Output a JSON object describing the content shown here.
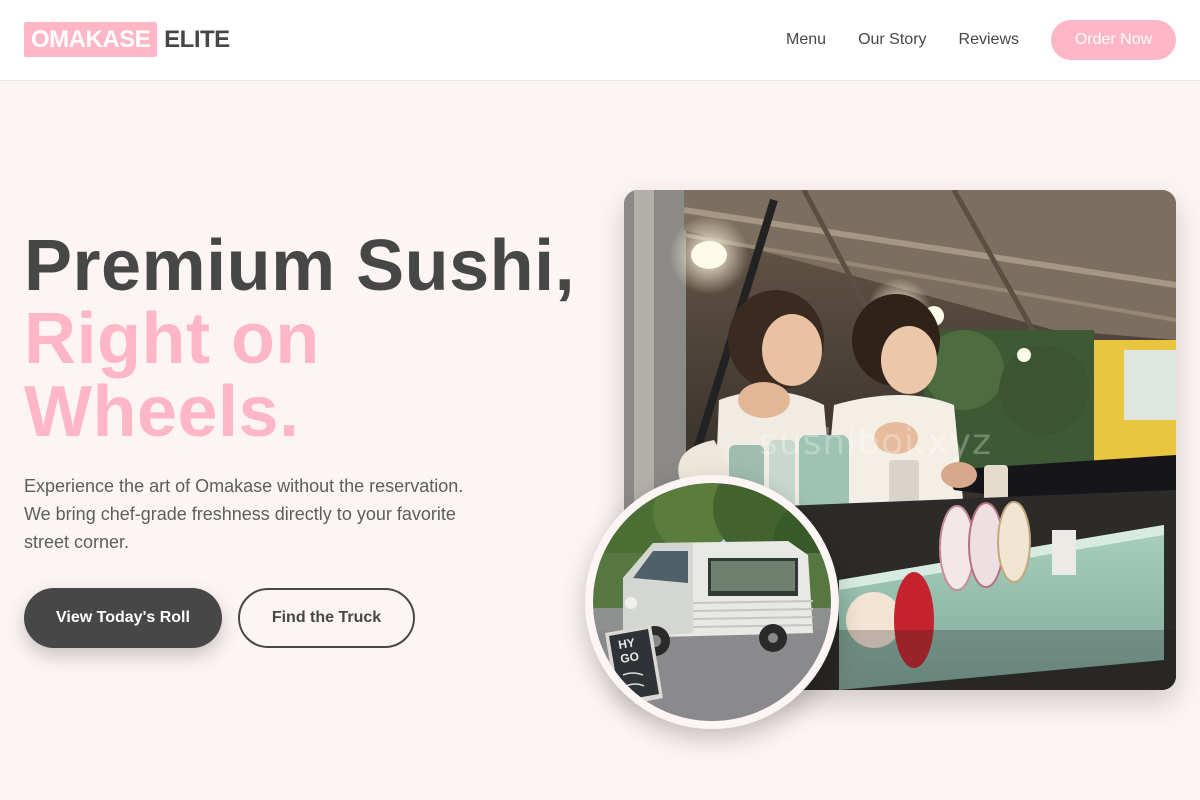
{
  "header": {
    "logo_badge": "OMAKASE",
    "logo_text": "ELITE",
    "nav": [
      "Menu",
      "Our Story",
      "Reviews"
    ],
    "order_label": "Order Now"
  },
  "hero": {
    "title_line1": "Premium Sushi,",
    "title_accent_line1": "Right on",
    "title_accent_line2": "Wheels.",
    "subtitle": "Experience the art of Omakase without the reservation. We bring chef-grade freshness directly to your favorite street corner.",
    "primary_button": "View Today's Roll",
    "secondary_button": "Find the Truck"
  },
  "images": {
    "main_watermark": "sushiboi.xyz",
    "sign_line1": "HY",
    "sign_line2": "GO"
  },
  "colors": {
    "accent": "#ffb6c6",
    "dark": "#474747",
    "background": "#fdf4f4"
  }
}
